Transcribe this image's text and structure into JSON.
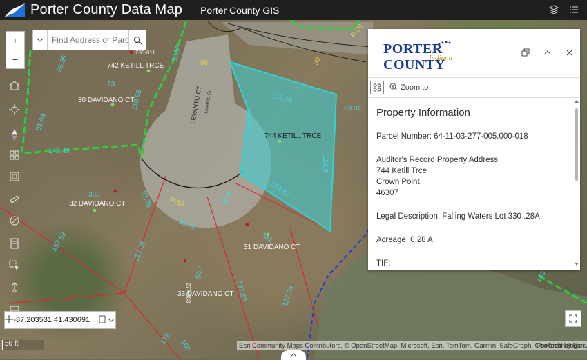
{
  "header": {
    "title": "Porter County Data Map",
    "subtitle": "Porter County GIS",
    "layers_icon": "layers-icon",
    "legend_icon": "legend-icon"
  },
  "search": {
    "placeholder": "Find Address or Parce..."
  },
  "map_labels": {
    "address_742": "742 KETILL TRCE",
    "address_744": "744 KETILL TRCE",
    "address_30": "30 DAVIDANO CT",
    "address_32": "32 DAVIDANO CT",
    "address_31": "31 DAVIDANO CT",
    "address_33": "33 DAVIDANO CT",
    "street_levanto": "LEVANTO CT",
    "street_levanto_small": "Levanto Ct",
    "parcel_285": "285-011",
    "parcel_277": "277-003",
    "road_r85": "R-85",
    "road_r20": "R-20",
    "dims": [
      "125.79",
      "80.84",
      "124.5",
      "122.82",
      "53.04",
      "110.95",
      "145.48",
      "91.64",
      "88.58",
      "26.35",
      "60",
      "30",
      "333",
      "23",
      "50.6",
      "50.76",
      "331",
      "137.52",
      "127.78",
      "157.52",
      "127.06",
      "91.75",
      "50.7",
      "160",
      "172",
      "149.93"
    ]
  },
  "coords": {
    "value": "-87.203531 41.430691 ..."
  },
  "scale": {
    "label": "50 ft"
  },
  "attribution": {
    "text": "Esri Community Maps Contributors, © OpenStreetMap, Microsoft, Esri, TomTom, Garmin, SafeGraph, GeoTechnologies, ...",
    "powered": "Powered by Esri"
  },
  "popup": {
    "logo_text": "PORTER COUNTY",
    "logo_sub": "Indiana",
    "zoom_label": "Zoom to",
    "section_title": "Property Information",
    "parcel_label": "Parcel Number:",
    "parcel_value": "64-11-03-277-005.000-018",
    "address_label": "Auditor's Record Property Address",
    "address_line1": "744 Ketill Trce",
    "address_line2": "Crown Point",
    "address_line3": "46307",
    "legal_label": "Legal Description:",
    "legal_value": "Falling Waters Lot 330 .28A",
    "acreage_label": "Acreage:",
    "acreage_value": "0.28 A",
    "tif_label": "TIF:"
  },
  "colors": {
    "header_bg": "#1f1f1f",
    "parcel_fill": "#3ad0d6",
    "parcel_line": "#2fd3d8",
    "green_boundary": "#2ecc40",
    "red_lines": "#d9262a",
    "water_blue": "#1c3fd1"
  }
}
